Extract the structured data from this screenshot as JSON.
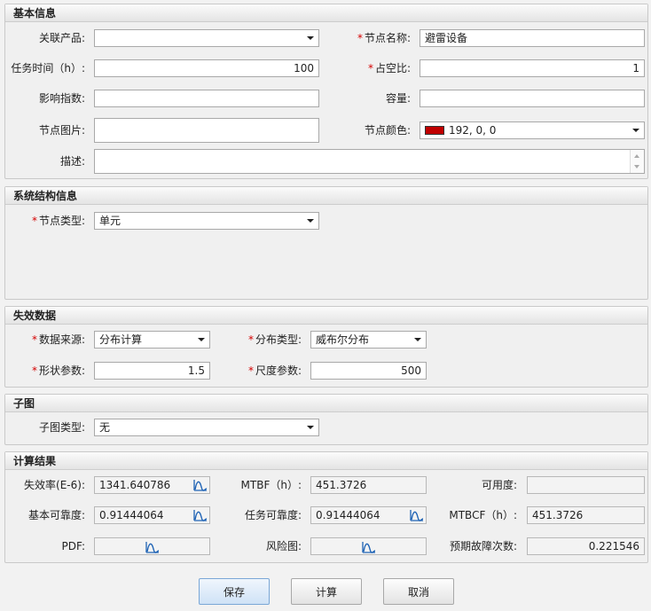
{
  "basic": {
    "title": "基本信息",
    "product_label": "关联产品:",
    "product_value": "",
    "node_name_label": "节点名称:",
    "node_name_value": "避雷设备",
    "task_time_label": "任务时间（h）:",
    "task_time_value": "100",
    "duty_ratio_label": "占空比:",
    "duty_ratio_value": "1",
    "influence_label": "影响指数:",
    "influence_value": "",
    "capacity_label": "容量:",
    "capacity_value": "",
    "node_image_label": "节点图片:",
    "node_color_label": "节点颜色:",
    "node_color_value": "192, 0, 0",
    "desc_label": "描述:",
    "desc_value": ""
  },
  "structure": {
    "title": "系统结构信息",
    "node_type_label": "节点类型:",
    "node_type_value": "单元"
  },
  "failure": {
    "title": "失效数据",
    "source_label": "数据来源:",
    "source_value": "分布计算",
    "dist_type_label": "分布类型:",
    "dist_type_value": "威布尔分布",
    "shape_label": "形状参数:",
    "shape_value": "1.5",
    "scale_label": "尺度参数:",
    "scale_value": "500"
  },
  "subgraph": {
    "title": "子图",
    "type_label": "子图类型:",
    "type_value": "无"
  },
  "results": {
    "title": "计算结果",
    "failure_rate_label": "失效率(E-6):",
    "failure_rate_value": "1341.640786",
    "mtbf_label": "MTBF（h）:",
    "mtbf_value": "451.3726",
    "availability_label": "可用度:",
    "availability_value": "",
    "basic_rel_label": "基本可靠度:",
    "basic_rel_value": "0.91444064",
    "task_rel_label": "任务可靠度:",
    "task_rel_value": "0.91444064",
    "mtbcf_label": "MTBCF（h）:",
    "mtbcf_value": "451.3726",
    "pdf_label": "PDF:",
    "risk_label": "风险图:",
    "expected_failures_label": "预期故障次数:",
    "expected_failures_value": "0.221546"
  },
  "buttons": {
    "save": "保存",
    "calc": "计算",
    "cancel": "取消"
  },
  "colors": {
    "node_color": "#c00000",
    "required": "#d40000",
    "icon": "#1f63b5"
  }
}
